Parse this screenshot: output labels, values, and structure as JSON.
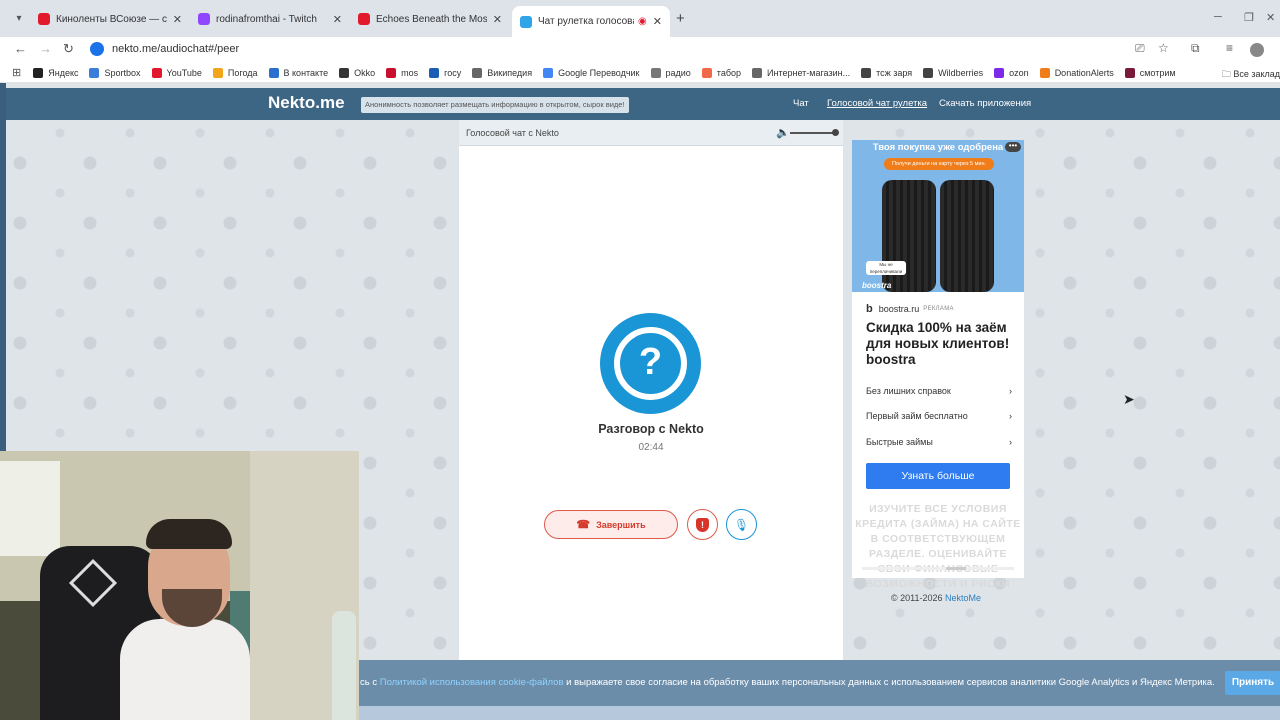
{
  "browser": {
    "tabs": [
      {
        "title": "Киноленты ВСоюзе — смотреть",
        "fav": "#e2192c"
      },
      {
        "title": "rodinafromthai - Twitch",
        "fav": "#9146ff"
      },
      {
        "title": "Echoes Beneath the Moss Organ",
        "fav": "#e2192c"
      },
      {
        "title": "Чат рулетка голосовая — ",
        "fav": "#2fa4e7"
      }
    ],
    "url": "nekto.me/audiochat#/peer",
    "bookmarks": [
      {
        "label": "Яндекс",
        "fav": "#222"
      },
      {
        "label": "Sportbox",
        "fav": "#3b7dd8"
      },
      {
        "label": "YouTube",
        "fav": "#e2192c"
      },
      {
        "label": "Погода",
        "fav": "#f2a51a"
      },
      {
        "label": "В контакте",
        "fav": "#2a6fd0"
      },
      {
        "label": "Okko",
        "fav": "#333"
      },
      {
        "label": "mos",
        "fav": "#c8102e"
      },
      {
        "label": "госу",
        "fav": "#1c5cb5"
      },
      {
        "label": "Википедия",
        "fav": "#666"
      },
      {
        "label": "Google Переводчик",
        "fav": "#4285f4"
      },
      {
        "label": "радио",
        "fav": "#777"
      },
      {
        "label": "табор",
        "fav": "#f06a4a"
      },
      {
        "label": "Интернет-магазин...",
        "fav": "#666"
      },
      {
        "label": "тсж заря",
        "fav": "#444"
      },
      {
        "label": "Wildberries",
        "fav": "#444"
      },
      {
        "label": "ozon",
        "fav": "#7d2ae8"
      },
      {
        "label": "DonationAlerts",
        "fav": "#f07d1a"
      },
      {
        "label": "смотрим",
        "fav": "#7a1a3a"
      }
    ],
    "all_bookmarks": "Все заклад"
  },
  "site": {
    "logo": "Nekto.me",
    "anon_note": "Анонимность позволяет размещать информацию в открытом, сырок виде!",
    "nav": [
      "Чат",
      "Голосовой чат рулетка",
      "Скачать приложения"
    ]
  },
  "chat": {
    "header_title": "Голосовой чат с Nekto",
    "volume_level": 1.0,
    "avatar_symbol": "?",
    "conversation_title": "Разговор с Nekto",
    "timer": "02:44",
    "end_button": "Завершить"
  },
  "ad": {
    "headline": "Твоя покупка уже одобрена",
    "pill": "Получи деньги на карту через 5 мин.",
    "chip": "Мы не переплачивали",
    "brand_image": "boostra",
    "domain": "boostra.ru",
    "domain_tag": "РЕКЛАМА",
    "title": "Скидка 100% на заём для новых клиентов! boostra",
    "features": [
      "Без лишних справок",
      "Первый займ бесплатно",
      "Быстрые займы"
    ],
    "cta": "Узнать больше",
    "disclaimer": "ИЗУЧИТЕ ВСЕ УСЛОВИЯ КРЕДИТА (ЗАЙМА) НА САЙТЕ В СООТВЕТСТВУЮЩЕМ РАЗДЕЛЕ. ОЦЕНИВАЙТЕ СВОИ ФИНАНСОВЫЕ ВОЗМОЖНОСТИ И РИСКИ"
  },
  "footer": {
    "copyright": "© 2011-2026 ",
    "copyright_link": "NektoMe"
  },
  "cookie": {
    "prefix": "сь с ",
    "link": "Политикой использования cookie-файлов",
    "suffix": " и выражаете свое согласие на обработку ваших персональных данных с использованием сервисов аналитики Google Analytics и Яндекс Метрика.",
    "accept": "Принять"
  }
}
